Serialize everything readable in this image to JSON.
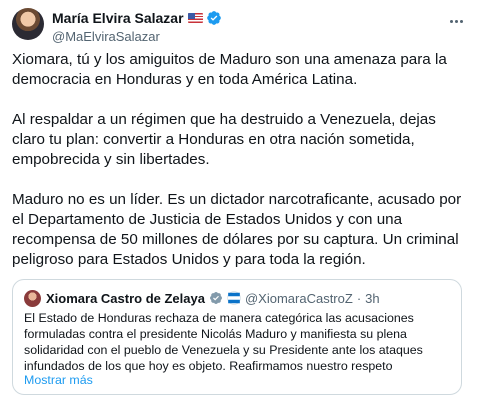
{
  "author": {
    "name": "María Elvira Salazar",
    "handle": "@MaElviraSalazar"
  },
  "tweet": {
    "paragraphs": [
      "Xiomara, tú y los amiguitos de Maduro son una amenaza para la democracia en Honduras y en toda América Latina.",
      "Al respaldar a un régimen que ha destruido a Venezuela, dejas claro tu plan: convertir a Honduras en otra nación sometida, empobrecida y sin libertades.",
      "Maduro no es un líder. Es un dictador narcotraficante, acusado por el Departamento de Justicia de Estados Unidos y con una recompensa de 50 millones de dólares por su captura. Un criminal peligroso para Estados Unidos y para toda la región."
    ]
  },
  "quoted": {
    "name": "Xiomara Castro de Zelaya",
    "handle": "@XiomaraCastroZ",
    "separator": "·",
    "time": "3h",
    "text": "El Estado de Honduras rechaza de manera categórica las acusaciones formuladas contra el presidente Nicolás Maduro y manifiesta su plena solidaridad con el pueblo de Venezuela y su Presidente ante los ataques infundados de los que hoy es objeto. Reafirmamos nuestro respeto",
    "show_more": "Mostrar más"
  },
  "icons": {
    "verified_color": "#1d9bf0",
    "link_color": "#1d9bf0",
    "author_flag": "us-flag-icon",
    "quoted_flag": "honduras-flag-icon"
  }
}
